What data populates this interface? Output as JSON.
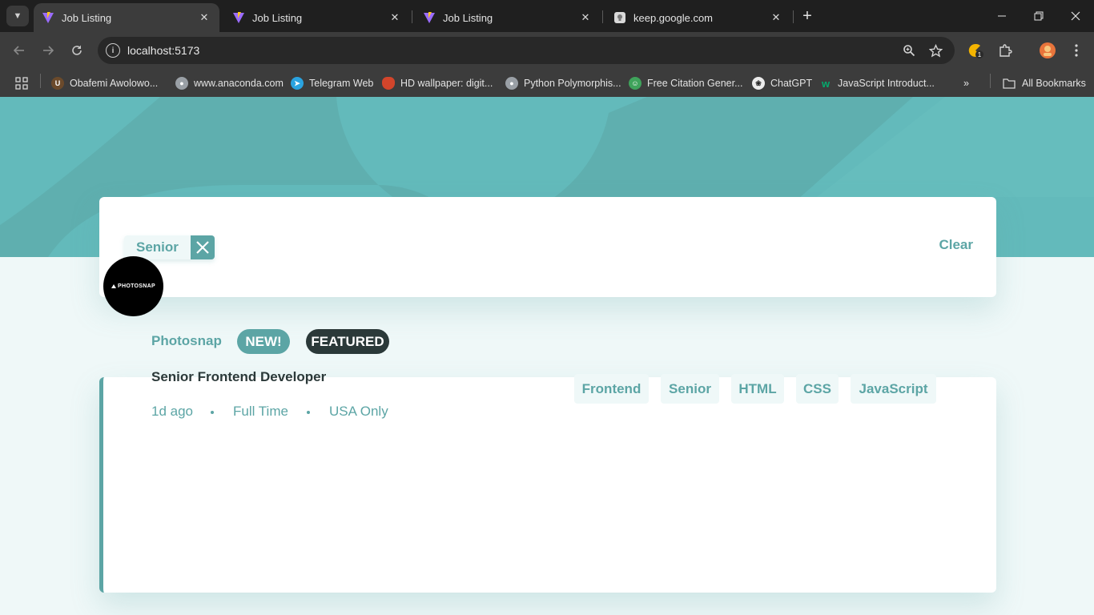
{
  "browser": {
    "tabs": [
      {
        "title": "Job Listing",
        "active": true
      },
      {
        "title": "Job Listing",
        "active": false
      },
      {
        "title": "Job Listing",
        "active": false
      },
      {
        "title": "keep.google.com",
        "active": false
      }
    ],
    "url": "localhost:5173",
    "extension_badge": "1",
    "bookmarks": [
      {
        "label": "Obafemi Awolowo..."
      },
      {
        "label": "www.anaconda.com"
      },
      {
        "label": "Telegram Web"
      },
      {
        "label": "HD wallpaper: digit..."
      },
      {
        "label": "Python Polymorphis..."
      },
      {
        "label": "Free Citation Gener..."
      },
      {
        "label": "ChatGPT"
      },
      {
        "label": "JavaScript Introduct..."
      }
    ],
    "all_bookmarks_label": "All Bookmarks"
  },
  "filter_bar": {
    "filters": [
      "Senior"
    ],
    "clear_label": "Clear"
  },
  "job": {
    "logo_text": "PHOTOSNAP",
    "company": "Photosnap",
    "new_badge": "NEW!",
    "featured_badge": "FEATURED",
    "position": "Senior Frontend Developer",
    "posted": "1d ago",
    "contract": "Full Time",
    "location": "USA Only",
    "tags": [
      "Frontend",
      "Senior",
      "HTML",
      "CSS",
      "JavaScript"
    ]
  },
  "colors": {
    "primary": "#5ca5a5",
    "header_bg": "#63babb",
    "page_bg": "#eff8f8",
    "dark": "#2b3939"
  }
}
